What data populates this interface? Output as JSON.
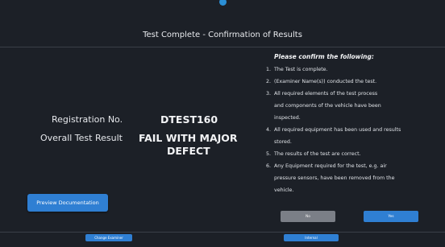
{
  "header": {
    "title": "Test Complete - Confirmation of Results"
  },
  "summary": {
    "registration_label": "Registration No.",
    "registration_value": "DTEST160",
    "result_label": "Overall Test Result",
    "result_value_line1": "FAIL WITH MAJOR",
    "result_value_line2": "DEFECT"
  },
  "confirmation": {
    "heading": "Please confirm the following:",
    "items": [
      {
        "num": "1.",
        "text": "The Test is complete."
      },
      {
        "num": "2.",
        "text": "(Examiner Name(s)) conducted the test."
      },
      {
        "num": "3.",
        "text": "All required elements of the test process"
      },
      {
        "num": "",
        "text": "and components of the vehicle have been"
      },
      {
        "num": "",
        "text": "inspected."
      },
      {
        "num": "4.",
        "text": "All required equipment has been used and results"
      },
      {
        "num": "",
        "text": "stored."
      },
      {
        "num": "5.",
        "text": "The results of the test are correct."
      },
      {
        "num": "6.",
        "text": "Any Equipment required for the test, e.g. air"
      },
      {
        "num": "",
        "text": "pressure sensors, have been removed from the"
      },
      {
        "num": "",
        "text": "vehicle."
      }
    ]
  },
  "buttons": {
    "preview": "Preview Documentation",
    "no": "No",
    "yes": "Yes",
    "change_examiner": "Change Examiner",
    "internal": "Internal"
  },
  "colors": {
    "background": "#1c2027",
    "accent": "#2f7fd3",
    "secondary_button": "#7b7f87"
  }
}
